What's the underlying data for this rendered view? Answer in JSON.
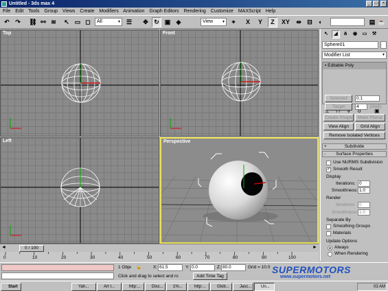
{
  "window": {
    "title": "Untitled - 3ds max 4"
  },
  "menu": [
    "File",
    "Edit",
    "Tools",
    "Group",
    "Views",
    "Create",
    "Modifiers",
    "Animation",
    "Graph Editors",
    "Rendering",
    "Customize",
    "MAXScript",
    "Help"
  ],
  "toolbar": {
    "selection_filter": "All",
    "ref_coord": "View",
    "axis_x": "X",
    "axis_y": "Y",
    "axis_z": "Z",
    "axis_xy": "XY"
  },
  "viewports": {
    "top": "Top",
    "front": "Front",
    "left": "Left",
    "perspective": "Perspective"
  },
  "panel": {
    "object_name": "Sphere01",
    "modifier_list": "Modifier List",
    "stack_item": "Editable Poly",
    "buttons": {
      "selected": "Selected",
      "target": "Target",
      "pixels": "pixels",
      "create_shape": "Create Shape",
      "make_planar": "Make Planar",
      "view_align": "View Align",
      "grid_align": "Grid Align",
      "remove_isolated": "Remove Isolated Vertices"
    },
    "spinner_top": "0.1",
    "spinner_target": "4",
    "rollouts": {
      "subdivide": "Subdivide",
      "surface": "Surface Properties"
    },
    "subdivide": {
      "use_nurms": "Use NURMS Subdivision",
      "smooth_result": "Smooth Result",
      "display": "Display",
      "iterations": "Iterations:",
      "iterations_val": "0",
      "smoothness": "Smoothness:",
      "smoothness_val": "1.0",
      "render": "Render",
      "r_iterations": "Iterations:",
      "r_iterations_val": "0",
      "r_smoothness": "Smoothness:",
      "r_smoothness_val": "1.0",
      "separate_by": "Separate By",
      "smoothing_groups": "Smoothing Groups",
      "materials": "Materials",
      "update_options": "Update Options",
      "always": "Always",
      "when_rendering": "When Rendering"
    },
    "rollout_signs": {
      "plus": "+",
      "minus": "-"
    }
  },
  "time": {
    "frame": "0 / 100",
    "ticks": [
      "0",
      "10",
      "20",
      "30",
      "40",
      "50",
      "60",
      "70",
      "80",
      "90",
      "100"
    ]
  },
  "status": {
    "selected_count": "1 Obje",
    "x_label": "X:",
    "x_val": "61.5",
    "y_label": "Y:",
    "y_val": "0.0",
    "z_label": "Z:",
    "z_val": "80.0",
    "grid": "Grid = 10.0",
    "prompt": "Click and drag to select and ro",
    "add_time_tag": "Add Time Tag"
  },
  "taskbar": {
    "start": "Start",
    "tasks": [
      "Yah...",
      "Art I...",
      "http:...",
      "Disc...",
      "1%...",
      "http:...",
      "Glob...",
      "Jasc...",
      "Un..."
    ],
    "clock": "03 AM"
  },
  "watermark": {
    "brand": "SUPERMOTORS",
    "url": "www.supermotors.net"
  }
}
